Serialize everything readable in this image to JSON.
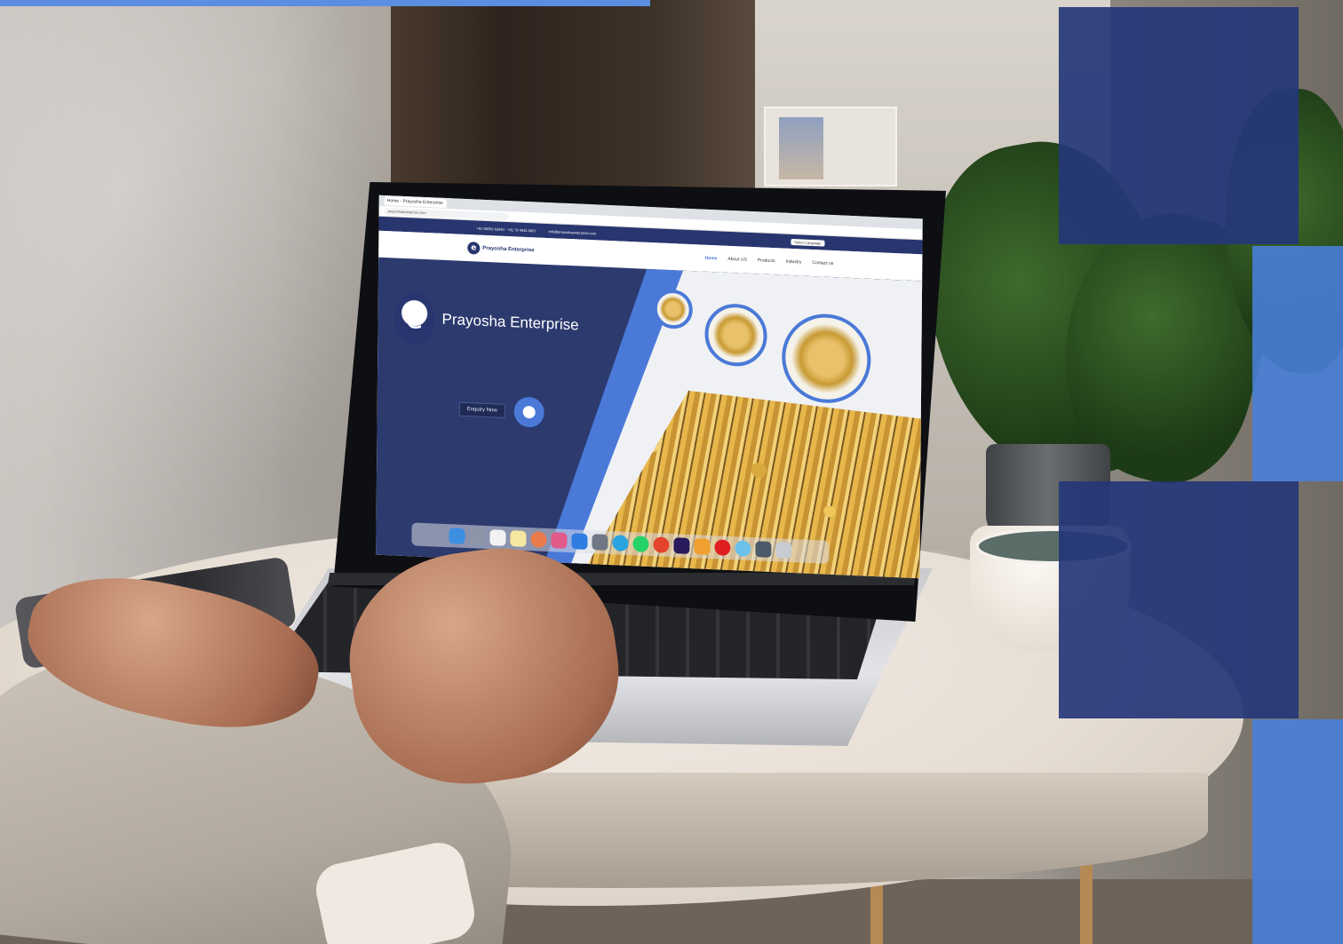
{
  "browser": {
    "tab_title": "Home - Prayosha Enterprise",
    "url": "prayoshaenterprise.com"
  },
  "topbar": {
    "phone": "+91 98253 62640 · +91 79 4031 0667",
    "email": "info@prayoshaenterprise.com",
    "translate_label": "Select Language"
  },
  "nav": {
    "brand": "Prayosha Enterprise",
    "menu": [
      "Home",
      "About US",
      "Products",
      "Industry",
      "Contact us"
    ]
  },
  "hero": {
    "brand_title": "Prayosha Enterprise",
    "enquiry_label": "Enquiry Now"
  },
  "colors": {
    "navy": "#253778",
    "accent_blue": "#4a80dc",
    "nav_active": "#4a79d8"
  }
}
